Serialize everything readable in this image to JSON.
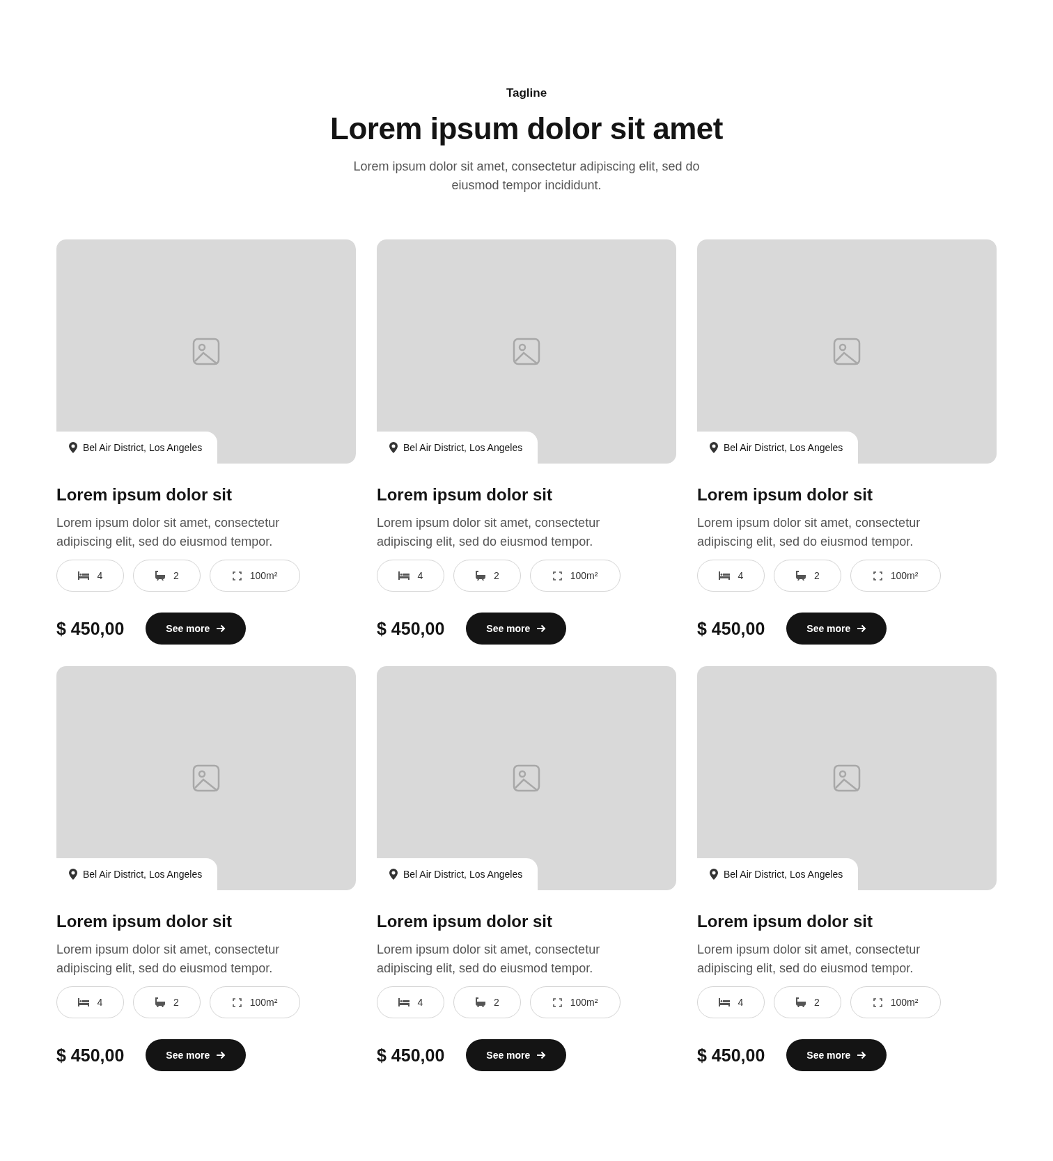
{
  "header": {
    "tagline": "Tagline",
    "title": "Lorem ipsum dolor sit amet",
    "subtitle": "Lorem ipsum dolor sit amet, consectetur adipiscing elit, sed do eiusmod tempor incididunt."
  },
  "cards": [
    {
      "location": "Bel Air District, Los Angeles",
      "title": "Lorem ipsum dolor sit",
      "description": "Lorem ipsum dolor sit amet, consectetur adipiscing elit, sed do eiusmod tempor.",
      "features": [
        {
          "kind": "beds",
          "value": "4"
        },
        {
          "kind": "baths",
          "value": "2"
        },
        {
          "kind": "area",
          "value": "100m²"
        }
      ],
      "price": "$ 450,00",
      "button": "See more"
    },
    {
      "location": "Bel Air District, Los Angeles",
      "title": "Lorem ipsum dolor sit",
      "description": "Lorem ipsum dolor sit amet, consectetur adipiscing elit, sed do eiusmod tempor.",
      "features": [
        {
          "kind": "beds",
          "value": "4"
        },
        {
          "kind": "baths",
          "value": "2"
        },
        {
          "kind": "area",
          "value": "100m²"
        }
      ],
      "price": "$ 450,00",
      "button": "See more"
    },
    {
      "location": "Bel Air District, Los Angeles",
      "title": "Lorem ipsum dolor sit",
      "description": "Lorem ipsum dolor sit amet, consectetur adipiscing elit, sed do eiusmod tempor.",
      "features": [
        {
          "kind": "beds",
          "value": "4"
        },
        {
          "kind": "baths",
          "value": "2"
        },
        {
          "kind": "area",
          "value": "100m²"
        }
      ],
      "price": "$ 450,00",
      "button": "See more"
    },
    {
      "location": "Bel Air District, Los Angeles",
      "title": "Lorem ipsum dolor sit",
      "description": "Lorem ipsum dolor sit amet, consectetur adipiscing elit, sed do eiusmod tempor.",
      "features": [
        {
          "kind": "beds",
          "value": "4"
        },
        {
          "kind": "baths",
          "value": "2"
        },
        {
          "kind": "area",
          "value": "100m²"
        }
      ],
      "price": "$ 450,00",
      "button": "See more"
    },
    {
      "location": "Bel Air District, Los Angeles",
      "title": "Lorem ipsum dolor sit",
      "description": "Lorem ipsum dolor sit amet, consectetur adipiscing elit, sed do eiusmod tempor.",
      "features": [
        {
          "kind": "beds",
          "value": "4"
        },
        {
          "kind": "baths",
          "value": "2"
        },
        {
          "kind": "area",
          "value": "100m²"
        }
      ],
      "price": "$ 450,00",
      "button": "See more"
    },
    {
      "location": "Bel Air District, Los Angeles",
      "title": "Lorem ipsum dolor sit",
      "description": "Lorem ipsum dolor sit amet, consectetur adipiscing elit, sed do eiusmod tempor.",
      "features": [
        {
          "kind": "beds",
          "value": "4"
        },
        {
          "kind": "baths",
          "value": "2"
        },
        {
          "kind": "area",
          "value": "100m²"
        }
      ],
      "price": "$ 450,00",
      "button": "See more"
    }
  ]
}
